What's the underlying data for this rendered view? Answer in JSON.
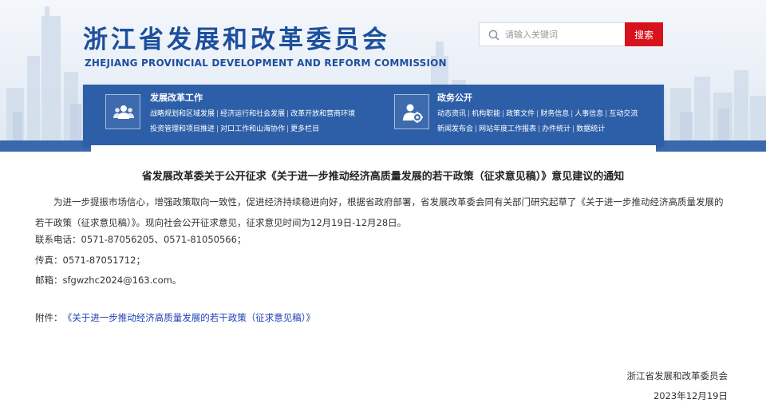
{
  "header": {
    "org_name_cn": "浙江省发展和改革委员会",
    "org_name_en": "ZHEJIANG PROVINCIAL DEVELOPMENT AND REFORM COMMISSION",
    "accent_color": "#1d4f9c"
  },
  "search": {
    "placeholder": "请输入关键词",
    "button_label": "搜索",
    "button_color": "#d7121c"
  },
  "nav": {
    "panel_color": "#2d5fa8",
    "groups": [
      {
        "title": "发展改革工作",
        "icon": "people-group-icon",
        "links": [
          "战略规划和区域发展",
          "经济运行和社会发展",
          "改革开放和营商环境",
          "投资管理和项目推进",
          "对口工作和山海协作",
          "更多栏目"
        ]
      },
      {
        "title": "政务公开",
        "icon": "user-settings-icon",
        "links": [
          "动态资讯",
          "机构职能",
          "政策文件",
          "财务信息",
          "人事信息",
          "互动交流",
          "新闻发布会",
          "网站年度工作报表",
          "办件统计",
          "数据统计"
        ]
      }
    ]
  },
  "article": {
    "title": "省发展改革委关于公开征求《关于进一步推动经济高质量发展的若干政策（征求意见稿）》意见建议的通知",
    "paragraph": "为进一步提振市场信心，增强政策取向一致性，促进经济持续稳进向好，根据省政府部署，省发展改革委会同有关部门研究起草了《关于进一步推动经济高质量发展的若干政策（征求意见稿）》。现向社会公开征求意见，征求意见时间为12月19日-12月28日。",
    "phone": "联系电话：0571-87056205、0571-81050566；",
    "fax": "传真：0571-87051712；",
    "email": "邮箱：sfgwzhc2024@163.com。",
    "attachment_label": "附件：",
    "attachment_link": "《关于进一步推动经济高质量发展的若干政策（征求意见稿）》",
    "signature_org": "浙江省发展和改革委员会",
    "signature_date": "2023年12月19日"
  }
}
